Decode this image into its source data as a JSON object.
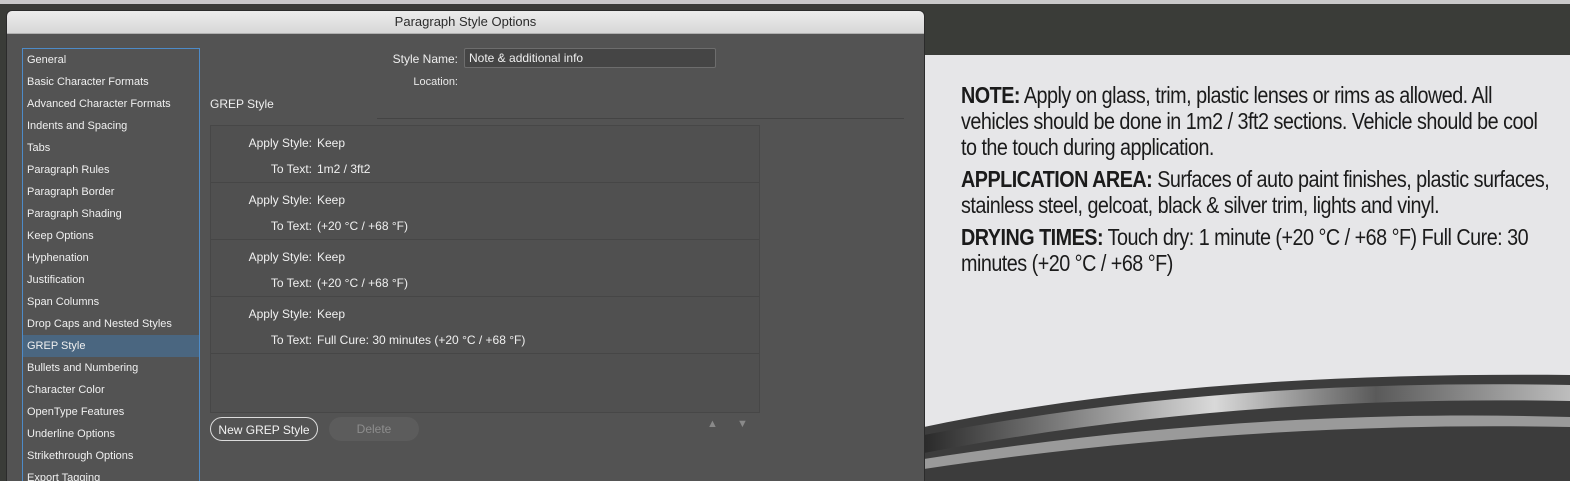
{
  "dialog": {
    "title": "Paragraph Style Options",
    "style_name_label": "Style Name:",
    "style_name_value": "Note & additional info",
    "location_label": "Location:",
    "section_title": "GREP Style"
  },
  "sidebar": {
    "items": [
      {
        "label": "General"
      },
      {
        "label": "Basic Character Formats"
      },
      {
        "label": "Advanced Character Formats"
      },
      {
        "label": "Indents and Spacing"
      },
      {
        "label": "Tabs"
      },
      {
        "label": "Paragraph Rules"
      },
      {
        "label": "Paragraph Border"
      },
      {
        "label": "Paragraph Shading"
      },
      {
        "label": "Keep Options"
      },
      {
        "label": "Hyphenation"
      },
      {
        "label": "Justification"
      },
      {
        "label": "Span Columns"
      },
      {
        "label": "Drop Caps and Nested Styles"
      },
      {
        "label": "GREP Style"
      },
      {
        "label": "Bullets and Numbering"
      },
      {
        "label": "Character Color"
      },
      {
        "label": "OpenType Features"
      },
      {
        "label": "Underline Options"
      },
      {
        "label": "Strikethrough Options"
      },
      {
        "label": "Export Tagging"
      }
    ],
    "active_index": 13
  },
  "grep_styles": {
    "apply_label": "Apply Style:",
    "to_text_label": "To Text:",
    "items": [
      {
        "apply_style": "Keep",
        "to_text": "1m2 / 3ft2"
      },
      {
        "apply_style": "Keep",
        "to_text": "(+20 °C / +68 °F)"
      },
      {
        "apply_style": "Keep",
        "to_text": "(+20 °C / +68 °F)"
      },
      {
        "apply_style": "Keep",
        "to_text": "Full Cure:  30 minutes (+20 °C / +68 °F)"
      }
    ]
  },
  "buttons": {
    "new_grep_style": "New GREP Style",
    "delete": "Delete",
    "move_up": "▲",
    "move_down": "▼"
  },
  "document": {
    "paragraphs": [
      {
        "bold": "NOTE:",
        "text": " Apply on glass, trim, plastic lenses or rims as allowed. All vehicles should be done in 1m2 / 3ft2 sections. Vehicle should be cool to the touch during application."
      },
      {
        "bold": "APPLICATION AREA:",
        "text": " Surfaces of auto paint finishes, plastic surfaces, stainless steel, gelcoat, black & silver trim, lights and vinyl."
      },
      {
        "bold": "DRYING TIMES:",
        "text": " Touch dry:  1 minute (+20 °C / +68 °F) Full Cure:  30 minutes (+20 °C / +68 °F)"
      }
    ]
  }
}
